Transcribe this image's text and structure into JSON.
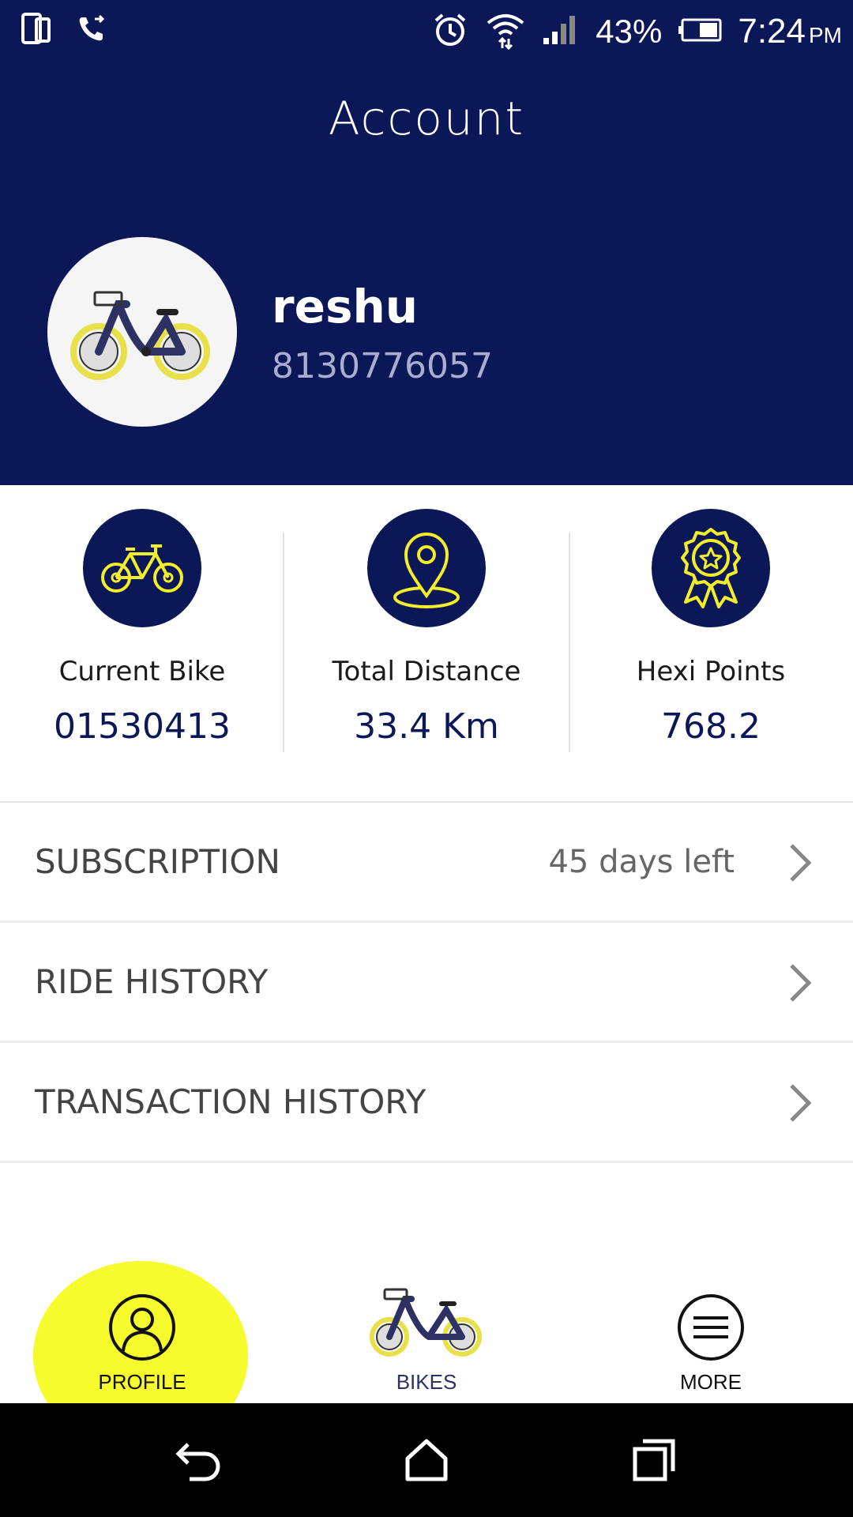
{
  "status_bar": {
    "battery_percent": "43%",
    "time": "7:24",
    "ampm": "PM",
    "icons": [
      "dual-window-icon",
      "wifi-call-icon",
      "alarm-icon",
      "wifi-icon",
      "signal-icon",
      "battery-icon"
    ]
  },
  "header": {
    "title": "Account",
    "user_name": "reshu",
    "user_phone": "8130776057"
  },
  "stats": [
    {
      "icon": "bicycle-icon",
      "label": "Current Bike",
      "value": "01530413"
    },
    {
      "icon": "location-pin-icon",
      "label": "Total Distance",
      "value": "33.4 Km"
    },
    {
      "icon": "award-badge-icon",
      "label": "Hexi Points",
      "value": "768.2"
    }
  ],
  "menu": {
    "subscription": {
      "label": "SUBSCRIPTION",
      "value": "45 days left"
    },
    "ride_history": {
      "label": "RIDE HISTORY"
    },
    "transaction_history": {
      "label": "TRANSACTION HISTORY"
    }
  },
  "bottom_nav": {
    "profile": "PROFILE",
    "bikes": "BIKES",
    "more": "MORE",
    "active": "profile"
  },
  "colors": {
    "brand_navy": "#0b1757",
    "accent_yellow": "#f6fb2e",
    "icon_yellow": "#f2ee2a"
  }
}
